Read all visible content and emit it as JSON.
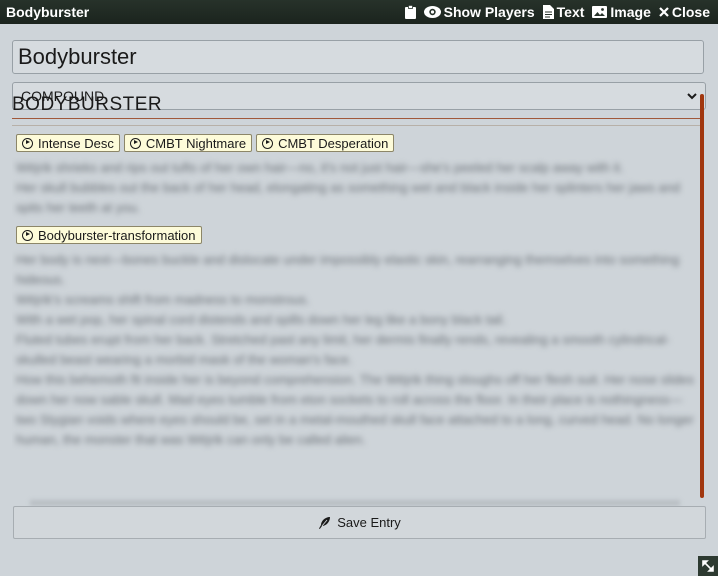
{
  "window": {
    "title": "Bodyburster",
    "actions": {
      "clipboard_icon": "clipboard-icon",
      "show_players": "Show Players",
      "text": "Text",
      "image": "Image",
      "close": "Close"
    }
  },
  "form": {
    "name_value": "Bodyburster",
    "type_value": "COMPOUND"
  },
  "entry": {
    "heading": "BODYBURSTER",
    "buttons_top": [
      "Intense Desc",
      "CMBT Nightmare",
      "CMBT Desperation"
    ],
    "para1": [
      "Wëjrik shrieks and rips out tufts of her own hair—no, it's not just hair—she's peeled her scalp away with it.",
      "Her skull bubbles out the back of her head, elongating as something wet and black inside her splinters her jaws and spits her teeth at you."
    ],
    "button_mid": "Bodyburster-transformation",
    "para2": [
      "Her body is next—bones buckle and dislocate under impossibly elastic skin, rearranging themselves into something hideous.",
      "Wëjrik's screams shift from madness to monstrous.",
      "With a wet pop, her spinal cord distends and spills down her leg like a bony black tail.",
      "Fluted tubes erupt from her back. Stretched past any limit, her dermis finally rends, revealing a smooth cylindrical-skulled beast wearing a morbid mask of the woman's face.",
      "How this behemoth fit inside her is beyond comprehension. The Wëjrik thing sloughs off her flesh suit. Her nose slides down her now sable skull. Mad eyes tumble from eton sockets to roll across the floor. In their place is nothingness—two Stygian voids where eyes should be, set in a metal-mouthed skull face attached to a long, curved head. No longer human, the monster that was Wëjrik can only be called alien."
    ]
  },
  "footer": {
    "save_label": "Save Entry"
  }
}
